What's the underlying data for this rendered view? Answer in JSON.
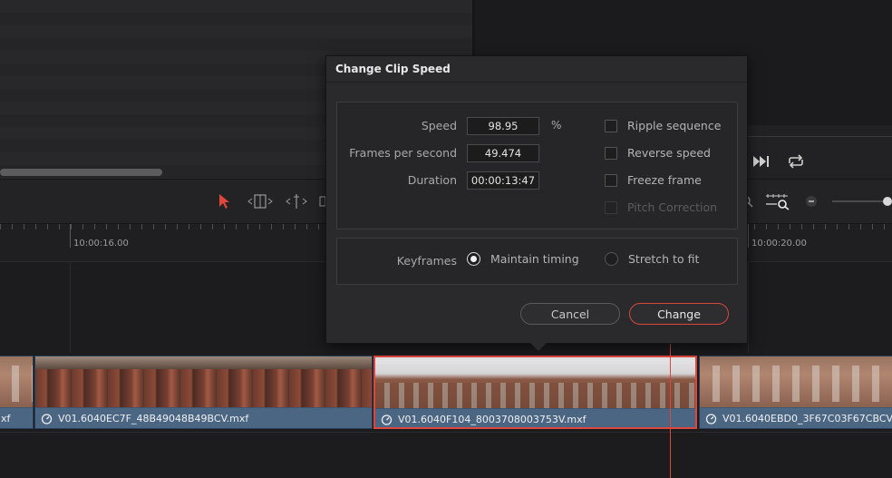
{
  "dialog": {
    "title": "Change Clip Speed",
    "fields": {
      "speed": {
        "label": "Speed",
        "value": "98.95",
        "unit": "%"
      },
      "fps": {
        "label": "Frames per second",
        "value": "49.474"
      },
      "duration": {
        "label": "Duration",
        "value": "00:00:13:47"
      }
    },
    "options": {
      "ripple": "Ripple sequence",
      "reverse": "Reverse speed",
      "freeze": "Freeze frame",
      "pitch": "Pitch Correction"
    },
    "keyframes": {
      "label": "Keyframes",
      "maintain": "Maintain timing",
      "stretch": "Stretch to fit",
      "selected": "maintain"
    },
    "buttons": {
      "cancel": "Cancel",
      "change": "Change"
    }
  },
  "timeline": {
    "timecodes": {
      "left": "10:00:16.00",
      "right": "10:00:20.00"
    },
    "clips": [
      {
        "name": "xf"
      },
      {
        "name": "V01.6040EC7F_48B49048B49BCV.mxf"
      },
      {
        "name": "V01.6040F104_8003708003753V.mxf",
        "selected": true
      },
      {
        "name": "V01.6040EBD0_3F67C03F67CBCV.mxf"
      }
    ]
  },
  "colors": {
    "accent": "#e0463c",
    "clip": "#4a6683"
  }
}
